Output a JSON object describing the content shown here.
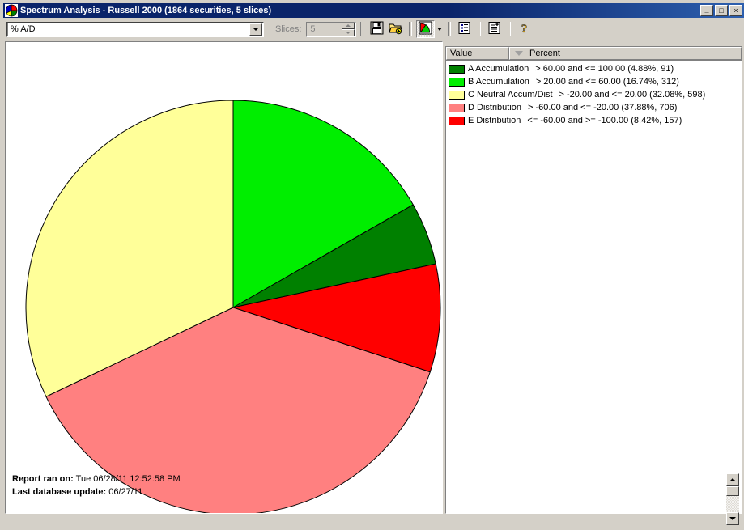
{
  "window": {
    "title": "Spectrum Analysis - Russell 2000 (1864 securities, 5 slices)",
    "icon": "pie-chart-icon",
    "minimize_label": "_",
    "maximize_label": "□",
    "close_label": "×"
  },
  "toolbar": {
    "field_select_value": "% A/D",
    "slices_label": "Slices:",
    "slices_value": "5",
    "buttons": [
      {
        "name": "save-button",
        "icon": "floppy-disk-icon"
      },
      {
        "name": "open-button",
        "icon": "open-folder-icon"
      },
      {
        "name": "chart-type-button",
        "icon": "pie-chart-icon"
      },
      {
        "name": "report-button",
        "icon": "list-report-icon"
      },
      {
        "name": "add-report-button",
        "icon": "list-add-icon"
      },
      {
        "name": "help-button",
        "icon": "question-mark-icon"
      }
    ]
  },
  "legend": {
    "columns": [
      "Value",
      "Percent"
    ],
    "sort_column": "Percent",
    "sort_direction": "descending",
    "rows": [
      {
        "color": "#008000",
        "label": "A Accumulation",
        "range": "> 60.00 and <= 100.00 (4.88%, 91)"
      },
      {
        "color": "#00EE00",
        "label": "B Accumulation",
        "range": "> 20.00 and <= 60.00 (16.74%, 312)"
      },
      {
        "color": "#FFFF99",
        "label": "C Neutral Accum/Dist",
        "range": "> -20.00 and <= 20.00 (32.08%, 598)"
      },
      {
        "color": "#FF8080",
        "label": "D Distribution",
        "range": "> -60.00 and <= -20.00 (37.88%, 706)"
      },
      {
        "color": "#FF0000",
        "label": "E Distribution",
        "range": "<= -60.00 and >= -100.00 (8.42%, 157)"
      }
    ]
  },
  "footer": {
    "report_ran_label": "Report ran on:",
    "report_ran_value": "Tue 06/28/11 12:52:58 PM",
    "last_update_label": "Last database update:",
    "last_update_value": "06/27/11"
  },
  "chart_data": {
    "type": "pie",
    "title": "Spectrum Analysis - Russell 2000",
    "total_securities": 1864,
    "slice_count": 5,
    "start_angle": 0,
    "direction": "clockwise",
    "center": [
      281,
      328
    ],
    "radius": 256,
    "categories": [
      "B Accumulation",
      "A Accumulation",
      "E Distribution",
      "D Distribution",
      "C Neutral Accum/Dist"
    ],
    "values": [
      16.74,
      4.88,
      8.42,
      37.88,
      32.08
    ],
    "counts": [
      312,
      91,
      157,
      706,
      598
    ],
    "colors": [
      "#00EE00",
      "#008000",
      "#FF0000",
      "#FF8080",
      "#FFFF99"
    ],
    "ranges": [
      "> 20.00 and <= 60.00",
      "> 60.00 and <= 100.00",
      "<= -60.00 and >= -100.00",
      "> -60.00 and <= -20.00",
      "> -20.00 and <= 20.00"
    ],
    "ylabel": "",
    "xlabel": "",
    "legend_position": "right"
  }
}
